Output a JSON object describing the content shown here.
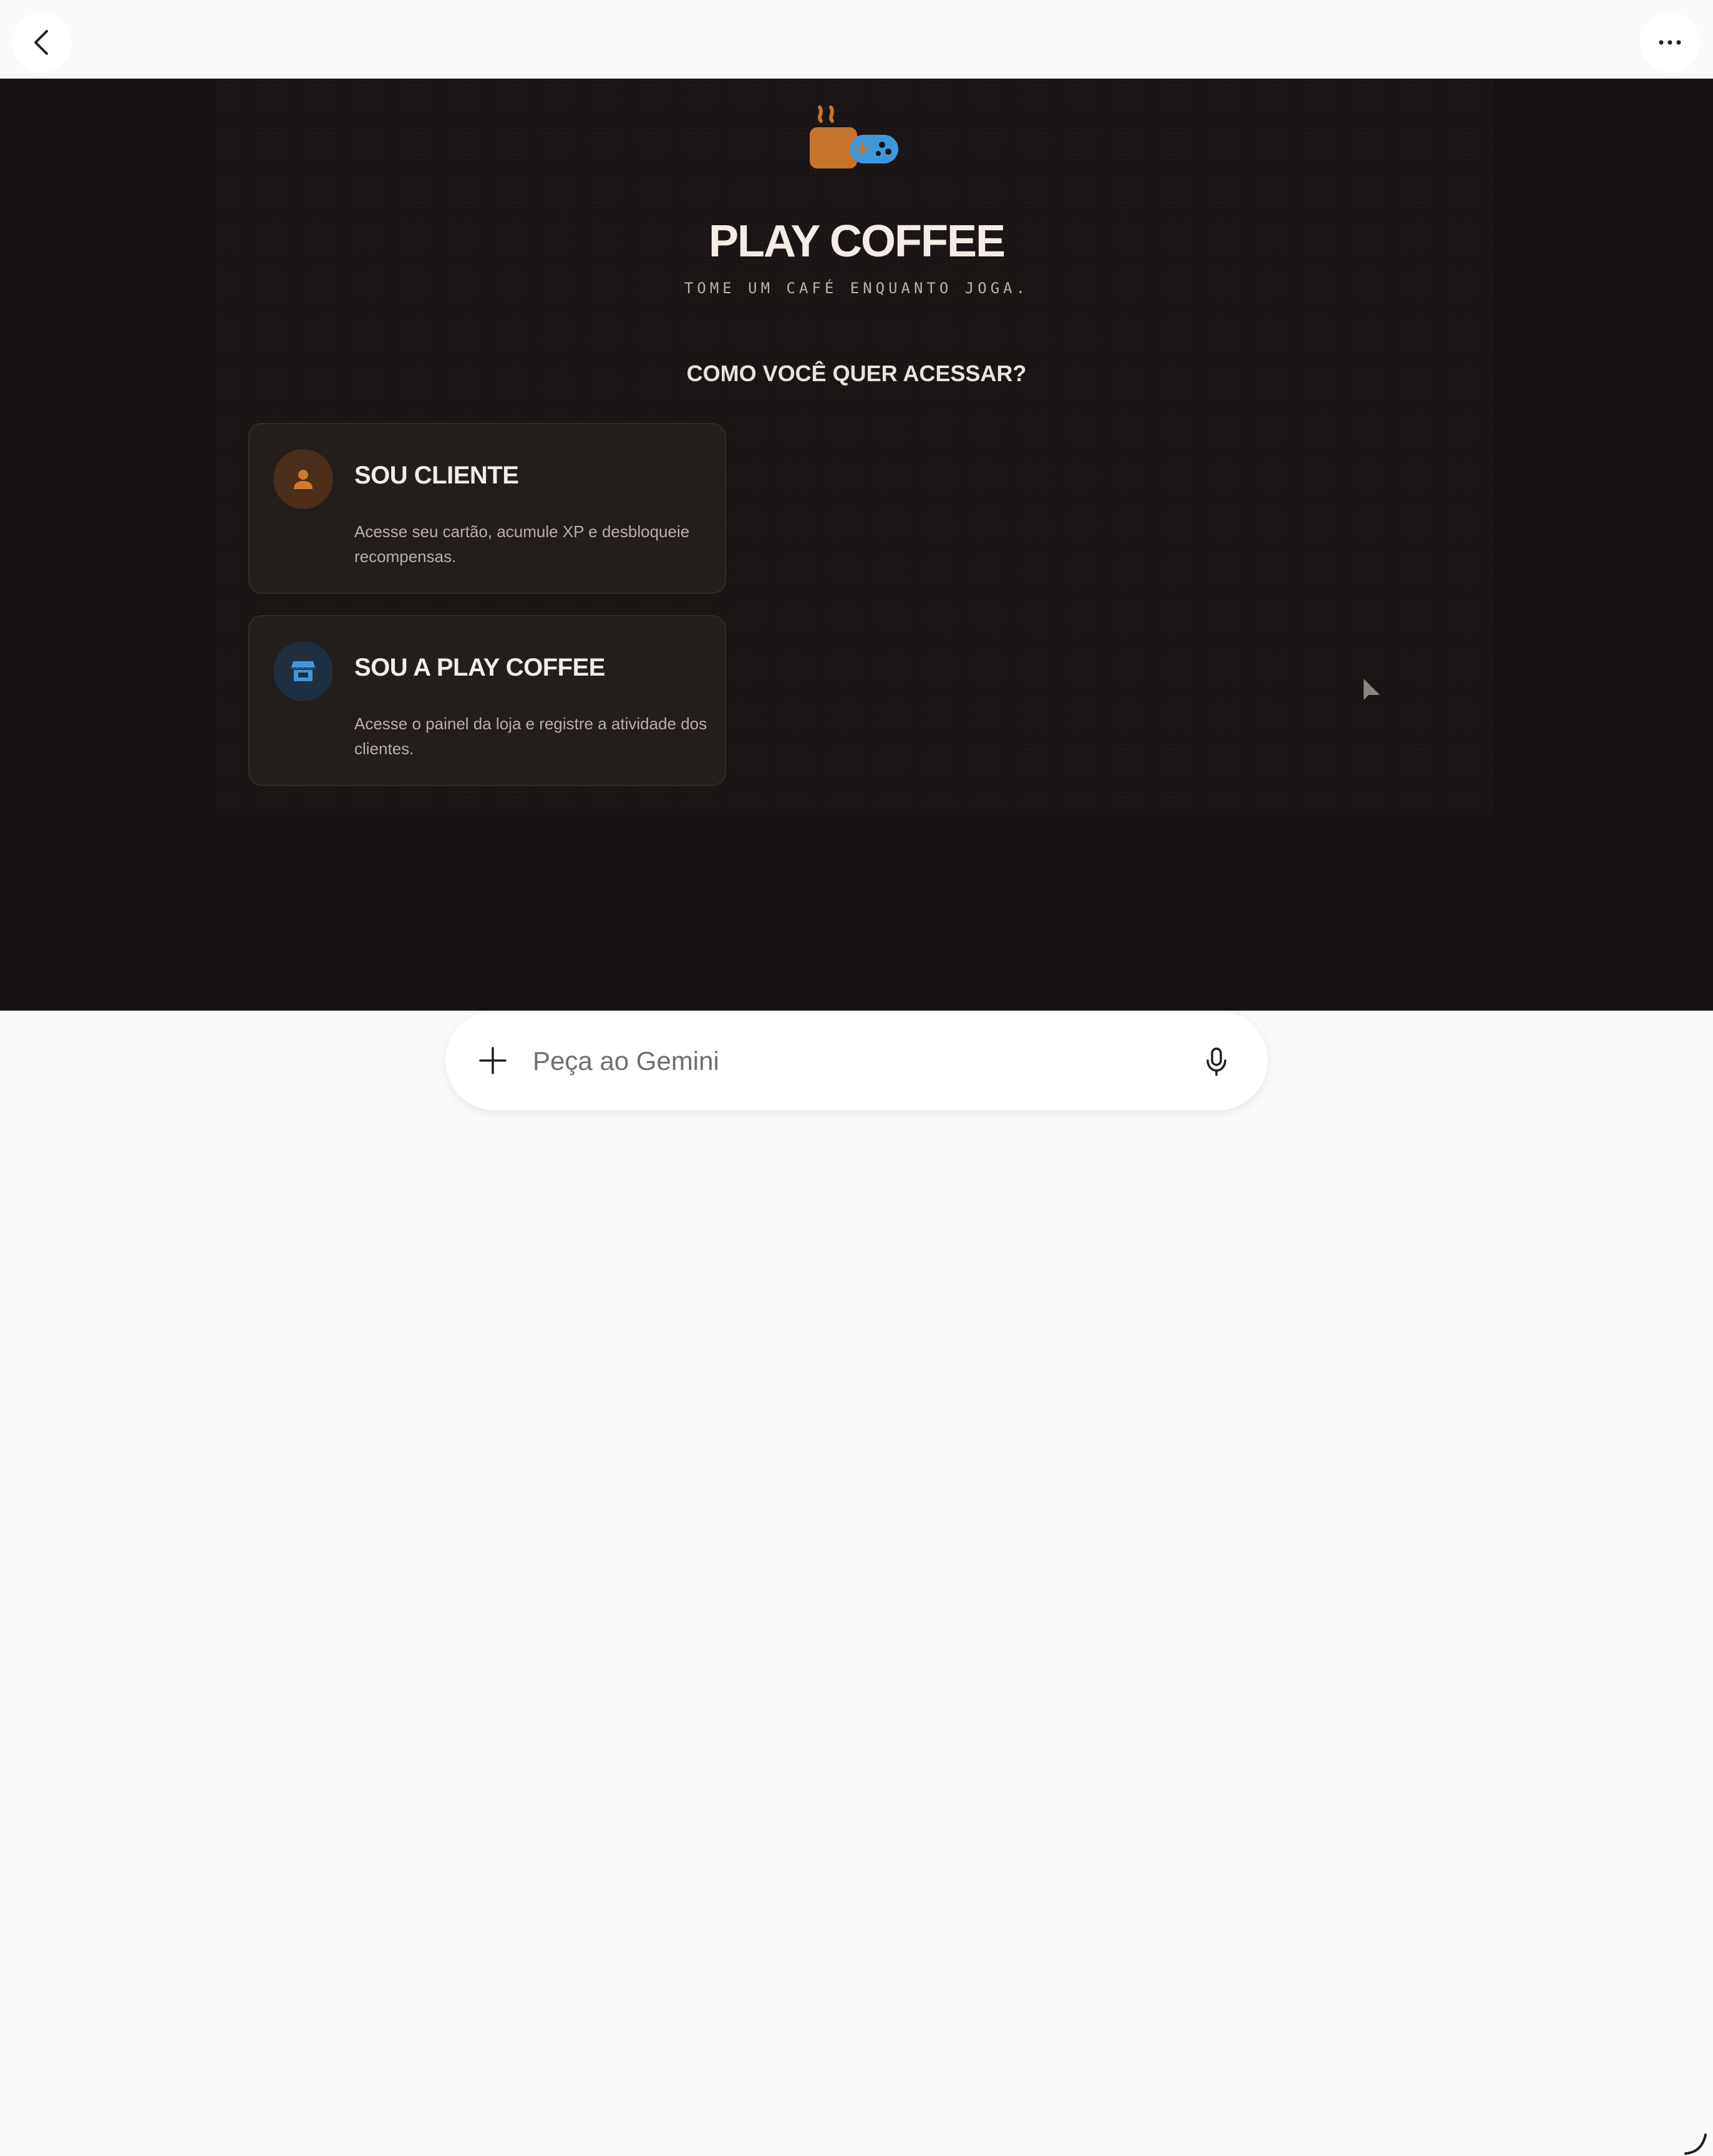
{
  "topbar": {
    "back_icon": "chevron-left-icon",
    "more_icon": "more-horizontal-icon"
  },
  "app": {
    "logo_icon": "coffee-gamepad-logo",
    "title": "PLAY COFFEE",
    "subtitle": "TOME UM CAFÉ ENQUANTO JOGA.",
    "question": "COMO VOCÊ QUER ACESSAR?",
    "options": [
      {
        "icon": "person-icon",
        "title": "SOU CLIENTE",
        "description": "Acesse seu cartão, acumule XP e desbloqueie recompensas."
      },
      {
        "icon": "storefront-icon",
        "title": "SOU A PLAY COFFEE",
        "description": "Acesse o painel da loja e registre a atividade dos clientes."
      }
    ]
  },
  "prompt": {
    "placeholder": "Peça ao Gemini",
    "value": "",
    "add_icon": "plus-icon",
    "mic_icon": "microphone-icon"
  },
  "colors": {
    "background": "#181312",
    "card": "#231d1b",
    "accent_orange": "#c8732b",
    "accent_blue": "#3f97db",
    "text_light": "#f3ede6"
  }
}
